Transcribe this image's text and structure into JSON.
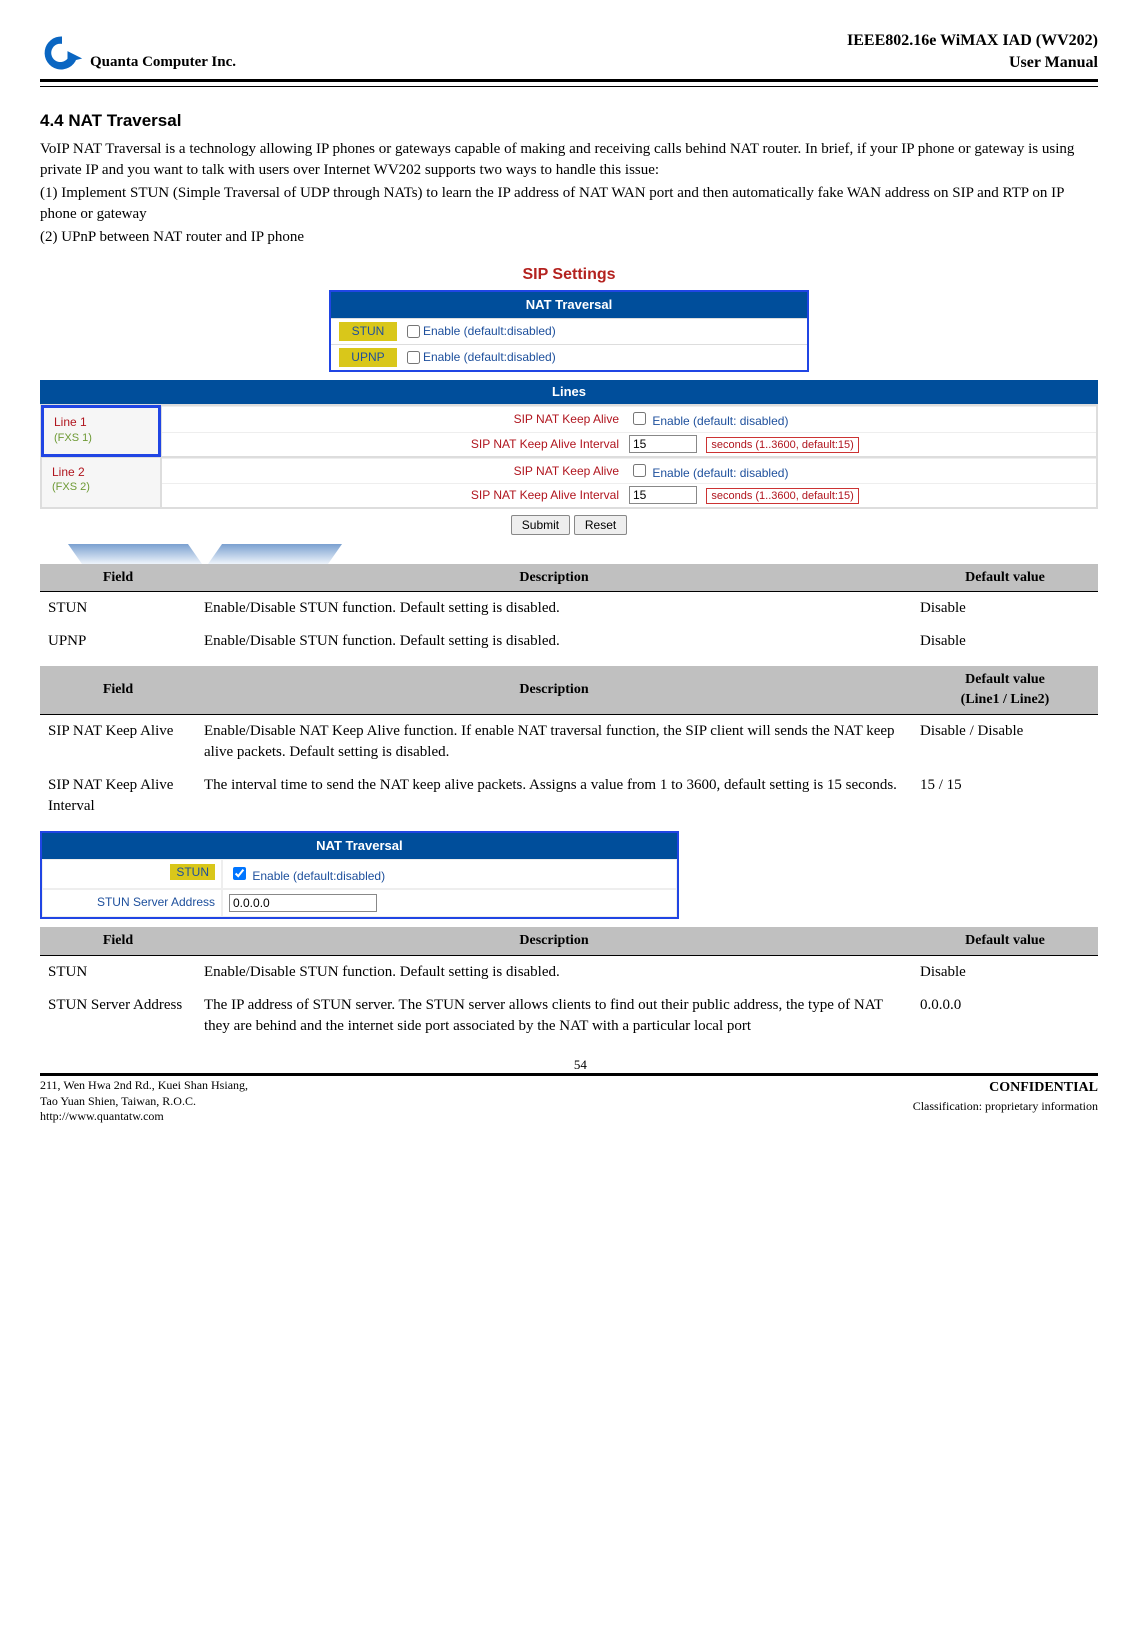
{
  "header": {
    "company": "Quanta  Computer  Inc.",
    "title_line1": "IEEE802.16e  WiMAX  IAD  (WV202)",
    "title_line2": "User  Manual"
  },
  "section": {
    "number_title": "4.4  NAT Traversal",
    "para1": "VoIP NAT Traversal is a technology allowing IP phones or gateways capable of making and receiving calls behind NAT router. In brief, if your IP phone or gateway is using private IP and you want to talk with users over Internet WV202 supports two ways to handle this issue:",
    "para2": "(1) Implement STUN (Simple Traversal of UDP through NATs) to learn the IP address of NAT WAN port and then automatically fake WAN address on SIP and RTP on IP phone or gateway",
    "para3": "(2) UPnP between NAT router and IP phone"
  },
  "sip": {
    "heading": "SIP Settings",
    "nat_tab": "NAT Traversal",
    "stun_label": "STUN",
    "upnp_label": "UPNP",
    "enable_default_disabled": "Enable (default:disabled)",
    "lines_tab": "Lines",
    "line1": {
      "label": "Line 1",
      "sub": "(FXS 1)"
    },
    "line2": {
      "label": "Line 2",
      "sub": "(FXS 2)"
    },
    "keep_alive_label": "SIP NAT Keep Alive",
    "enable_default_disabled_space": "Enable (default: disabled)",
    "keep_alive_interval_label": "SIP NAT Keep Alive Interval",
    "interval_value": "15",
    "seconds_note": "seconds (1..3600, default:15)",
    "submit": "Submit",
    "reset": "Reset"
  },
  "table1": {
    "h_field": "Field",
    "h_desc": "Description",
    "h_default": "Default value",
    "r0": {
      "f": "STUN",
      "d": "Enable/Disable STUN function. Default setting is disabled.",
      "v": "Disable"
    },
    "r1": {
      "f": "UPNP",
      "d": "Enable/Disable STUN function. Default setting is disabled.",
      "v": "Disable"
    }
  },
  "table2": {
    "h_field": "Field",
    "h_desc": "Description",
    "h_default_l1": "Default value",
    "h_default_l2": "(Line1 / Line2)",
    "r0": {
      "f": "SIP NAT Keep Alive",
      "d": "Enable/Disable NAT Keep Alive function. If enable NAT traversal function, the SIP client will sends the NAT keep alive packets. Default setting is disabled.",
      "v": "Disable / Disable"
    },
    "r1": {
      "f": "SIP NAT Keep Alive Interval",
      "d": "The interval time to send the NAT keep alive packets. Assigns a value from 1 to 3600, default setting is 15 seconds.",
      "v": "15 / 15"
    }
  },
  "natbox": {
    "title": "NAT Traversal",
    "stun_label": "STUN",
    "stun_check": "Enable (default:disabled)",
    "server_label": "STUN Server Address",
    "server_value": "0.0.0.0"
  },
  "table3": {
    "h_field": "Field",
    "h_desc": "Description",
    "h_default": "Default value",
    "r0": {
      "f": "STUN",
      "d": "Enable/Disable STUN function. Default setting is disabled.",
      "v": "Disable"
    },
    "r1": {
      "f": "STUN Server Address",
      "d": "The IP address of STUN server. The STUN server allows clients to find out their public address, the type of NAT they are behind and the internet side port associated by the NAT with a particular local port",
      "v": "0.0.0.0"
    }
  },
  "footer": {
    "addr1": "211, Wen Hwa 2nd Rd., Kuei Shan Hsiang,",
    "addr2": "Tao Yuan Shien, Taiwan, R.O.C.",
    "url": "http://www.quantatw.com",
    "page": "54",
    "conf": "CONFIDENTIAL",
    "class": "Classification: proprietary information"
  }
}
